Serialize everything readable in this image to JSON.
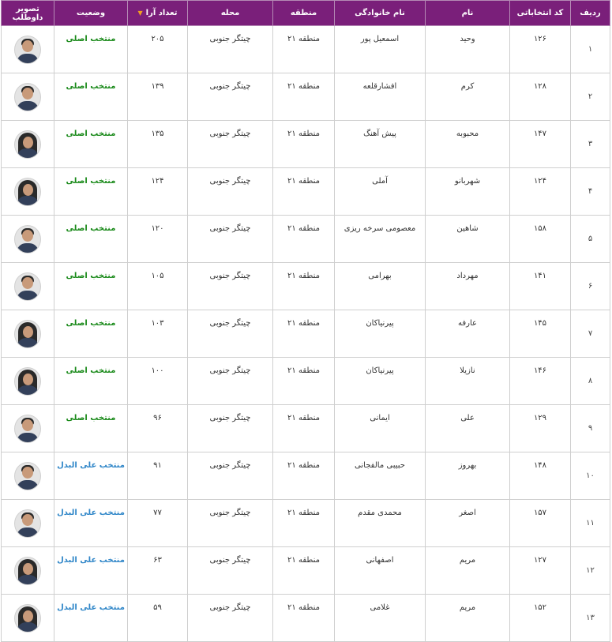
{
  "headers": {
    "row": "ردیف",
    "code": "کد انتخاباتی",
    "first": "نام",
    "last": "نام خانوادگی",
    "region": "منطقه",
    "district": "محله",
    "votes": "تعداد آرا",
    "status": "وضعیت",
    "photo": "تصویر داوطلب"
  },
  "sort_indicator": "▼",
  "colors": {
    "header_bg": "#7a1f7a",
    "main_status": "#1a8a1a",
    "alt_status": "#2f86c8"
  },
  "rows": [
    {
      "row": "۱",
      "code": "۱۲۶",
      "first": "وحید",
      "last": "اسمعیل پور",
      "region": "منطقه ۲۱",
      "district": "چیتگر جنوبی",
      "votes": "۲۰۵",
      "status": "منتخب اصلی",
      "kind": "main",
      "gender": "m"
    },
    {
      "row": "۲",
      "code": "۱۲۸",
      "first": "کرم",
      "last": "افشارقلعه",
      "region": "منطقه ۲۱",
      "district": "چیتگر جنوبی",
      "votes": "۱۳۹",
      "status": "منتخب اصلی",
      "kind": "main",
      "gender": "m"
    },
    {
      "row": "۳",
      "code": "۱۴۷",
      "first": "محبوبه",
      "last": "پیش آهنگ",
      "region": "منطقه ۲۱",
      "district": "چیتگر جنوبی",
      "votes": "۱۳۵",
      "status": "منتخب اصلی",
      "kind": "main",
      "gender": "f"
    },
    {
      "row": "۴",
      "code": "۱۲۴",
      "first": "شهربانو",
      "last": "آملی",
      "region": "منطقه ۲۱",
      "district": "چیتگر جنوبی",
      "votes": "۱۲۴",
      "status": "منتخب اصلی",
      "kind": "main",
      "gender": "f"
    },
    {
      "row": "۵",
      "code": "۱۵۸",
      "first": "شاهین",
      "last": "معصومی سرخه ریزی",
      "region": "منطقه ۲۱",
      "district": "چیتگر جنوبی",
      "votes": "۱۲۰",
      "status": "منتخب اصلی",
      "kind": "main",
      "gender": "m"
    },
    {
      "row": "۶",
      "code": "۱۴۱",
      "first": "مهرداد",
      "last": "بهرامی",
      "region": "منطقه ۲۱",
      "district": "چیتگر جنوبی",
      "votes": "۱۰۵",
      "status": "منتخب اصلی",
      "kind": "main",
      "gender": "m"
    },
    {
      "row": "۷",
      "code": "۱۴۵",
      "first": "عارفه",
      "last": "پیرنیاکان",
      "region": "منطقه ۲۱",
      "district": "چیتگر جنوبی",
      "votes": "۱۰۳",
      "status": "منتخب اصلی",
      "kind": "main",
      "gender": "f"
    },
    {
      "row": "۸",
      "code": "۱۴۶",
      "first": "نازیلا",
      "last": "پیرنیاکان",
      "region": "منطقه ۲۱",
      "district": "چیتگر جنوبی",
      "votes": "۱۰۰",
      "status": "منتخب اصلی",
      "kind": "main",
      "gender": "f"
    },
    {
      "row": "۹",
      "code": "۱۲۹",
      "first": "علی",
      "last": "ایمانی",
      "region": "منطقه ۲۱",
      "district": "چیتگر جنوبی",
      "votes": "۹۶",
      "status": "منتخب اصلی",
      "kind": "main",
      "gender": "m"
    },
    {
      "row": "۱۰",
      "code": "۱۴۸",
      "first": "بهروز",
      "last": "حبیبی مالفجانی",
      "region": "منطقه ۲۱",
      "district": "چیتگر جنوبی",
      "votes": "۹۱",
      "status": "منتخب علی البدل",
      "kind": "alt",
      "gender": "m"
    },
    {
      "row": "۱۱",
      "code": "۱۵۷",
      "first": "اصغر",
      "last": "محمدی مقدم",
      "region": "منطقه ۲۱",
      "district": "چیتگر جنوبی",
      "votes": "۷۷",
      "status": "منتخب علی البدل",
      "kind": "alt",
      "gender": "m"
    },
    {
      "row": "۱۲",
      "code": "۱۲۷",
      "first": "مریم",
      "last": "اصفهانی",
      "region": "منطقه ۲۱",
      "district": "چیتگر جنوبی",
      "votes": "۶۳",
      "status": "منتخب علی البدل",
      "kind": "alt",
      "gender": "f"
    },
    {
      "row": "۱۳",
      "code": "۱۵۲",
      "first": "مریم",
      "last": "غلامی",
      "region": "منطقه ۲۱",
      "district": "چیتگر جنوبی",
      "votes": "۵۹",
      "status": "منتخب علی البدل",
      "kind": "alt",
      "gender": "f"
    }
  ]
}
